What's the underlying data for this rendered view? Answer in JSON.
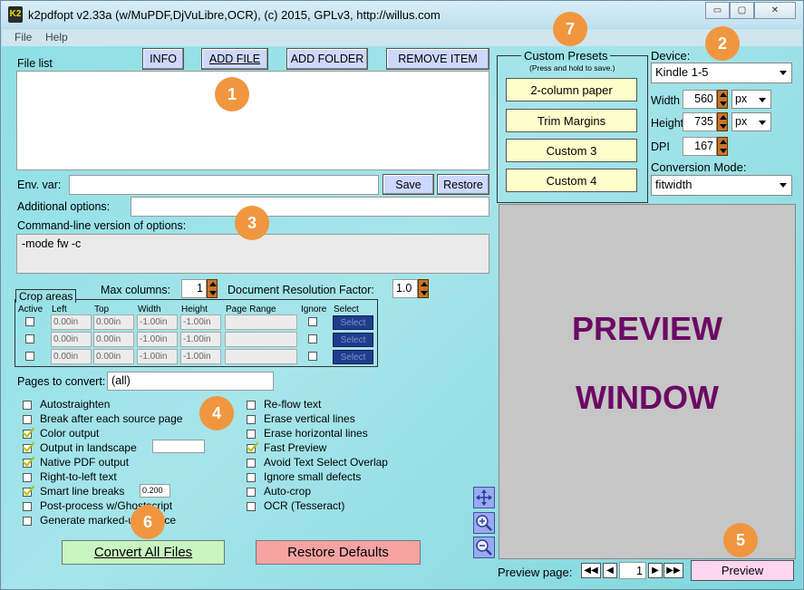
{
  "window": {
    "icon_text": "K2",
    "title": "k2pdfopt v2.33a (w/MuPDF,DjVuLibre,OCR), (c) 2015, GPLv3, http://willus.com",
    "controls": {
      "minimize": "▭",
      "maximize": "▢",
      "close": "✕"
    }
  },
  "menu": {
    "file": "File",
    "help": "Help"
  },
  "file_list": {
    "label": "File list",
    "buttons": {
      "info": "INFO",
      "add_file": "ADD FILE",
      "add_folder": "ADD FOLDER",
      "remove_item": "REMOVE ITEM"
    }
  },
  "env": {
    "label": "Env. var:",
    "value": "",
    "save": "Save",
    "restore": "Restore"
  },
  "additional": {
    "label": "Additional options:",
    "value": ""
  },
  "cmdline": {
    "label": "Command-line version of options:",
    "value": "-mode fw -c"
  },
  "columns": {
    "max_label": "Max columns:",
    "max_value": "1",
    "res_label": "Document Resolution Factor:",
    "res_value": "1.0"
  },
  "crop": {
    "title": "Crop areas",
    "headers": [
      "Active",
      "Left",
      "Top",
      "Width",
      "Height",
      "Page Range",
      "Ignore",
      "Select"
    ],
    "rows": [
      {
        "left": "0.00in",
        "top": "0.00in",
        "width": "-1.00in",
        "height": "-1.00in",
        "select": "Select"
      },
      {
        "left": "0.00in",
        "top": "0.00in",
        "width": "-1.00in",
        "height": "-1.00in",
        "select": "Select"
      },
      {
        "left": "0.00in",
        "top": "0.00in",
        "width": "-1.00in",
        "height": "-1.00in",
        "select": "Select"
      }
    ]
  },
  "pages": {
    "label": "Pages to convert:",
    "value": "(all)"
  },
  "options_left": [
    {
      "label": "Autostraighten",
      "checked": false
    },
    {
      "label": "Break after each source page",
      "checked": false
    },
    {
      "label": "Color output",
      "checked": true
    },
    {
      "label": "Output in landscape",
      "checked": true
    },
    {
      "label": "Native PDF output",
      "checked": true
    },
    {
      "label": "Right-to-left text",
      "checked": false
    },
    {
      "label": "Smart line breaks",
      "checked": true,
      "value": "0.200"
    },
    {
      "label": "Post-process w/Ghostscript",
      "checked": false
    },
    {
      "label": "Generate marked-up source",
      "checked": false
    }
  ],
  "options_right": [
    {
      "label": "Re-flow text",
      "checked": false
    },
    {
      "label": "Erase vertical lines",
      "checked": false
    },
    {
      "label": "Erase horizontal lines",
      "checked": false
    },
    {
      "label": "Fast Preview",
      "checked": true
    },
    {
      "label": "Avoid Text Select Overlap",
      "checked": false
    },
    {
      "label": "Ignore small defects",
      "checked": false
    },
    {
      "label": "Auto-crop",
      "checked": false
    },
    {
      "label": "OCR (Tesseract)",
      "checked": false
    }
  ],
  "actions": {
    "convert": "Convert All Files",
    "restore_defaults": "Restore Defaults"
  },
  "presets": {
    "title": "Custom Presets",
    "subtitle": "(Press and hold to save.)",
    "items": [
      "2-column paper",
      "Trim Margins",
      "Custom 3",
      "Custom 4"
    ]
  },
  "device": {
    "label": "Device:",
    "selected": "Kindle 1-5",
    "width_label": "Width",
    "width_value": "560",
    "width_unit": "px",
    "height_label": "Height",
    "height_value": "735",
    "height_unit": "px",
    "dpi_label": "DPI",
    "dpi_value": "167",
    "mode_label": "Conversion Mode:",
    "mode_value": "fitwidth"
  },
  "preview": {
    "line1": "PREVIEW",
    "line2": "WINDOW",
    "page_label": "Preview page:",
    "page_value": "1",
    "button": "Preview",
    "nav": {
      "first": "◀◀",
      "prev": "◀",
      "next": "▶",
      "last": "▶▶"
    }
  },
  "badges": [
    "1",
    "2",
    "3",
    "4",
    "5",
    "6",
    "7"
  ],
  "colors": {
    "accent_badge": "#f0963f",
    "preview_text": "#6b0a64",
    "preset_bg": "#ffffcc",
    "convert_bg": "#c8f5c0",
    "restore_bg": "#f7a3a3"
  }
}
